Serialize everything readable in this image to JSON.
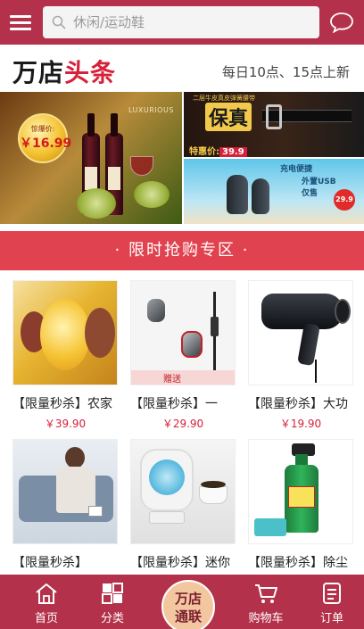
{
  "header": {
    "search_placeholder": "休闲/运动鞋",
    "menu_icon": "menu-icon",
    "chat_icon": "chat-icon"
  },
  "headline": {
    "logo_part1": "万店",
    "logo_part2": "头条",
    "note": "每日10点、15点上新"
  },
  "banners": {
    "wine": {
      "badge_label": "惊爆价:",
      "badge_price": "￥16.99",
      "brand": "LUXURIOUS"
    },
    "belt": {
      "title": "保真",
      "subtitle": "二层牛皮真皮弹簧腰带",
      "price_label": "特惠价:",
      "price": "39.9"
    },
    "bag": {
      "line1": "充电便捷",
      "line2": "外置USB",
      "line3": "仅售",
      "price": "29.9"
    }
  },
  "section": {
    "title": "·  限时抢购专区  ·"
  },
  "products": [
    {
      "title": "【限量秒杀】农家",
      "price": "￥39.90"
    },
    {
      "title": "【限量秒杀】一",
      "price": "￥29.90"
    },
    {
      "title": "【限量秒杀】大功",
      "price": "￥19.90"
    },
    {
      "title": "【限量秒杀】",
      "price": ""
    },
    {
      "title": "【限量秒杀】迷你",
      "price": ""
    },
    {
      "title": "【限量秒杀】除尘",
      "price": ""
    }
  ],
  "tabbar": {
    "home": "首页",
    "category": "分类",
    "center_line1": "万店",
    "center_line2": "通联",
    "cart": "购物车",
    "orders": "订单"
  },
  "colors": {
    "brand": "#b3314a",
    "section": "#e0434f",
    "price": "#d6213a"
  }
}
